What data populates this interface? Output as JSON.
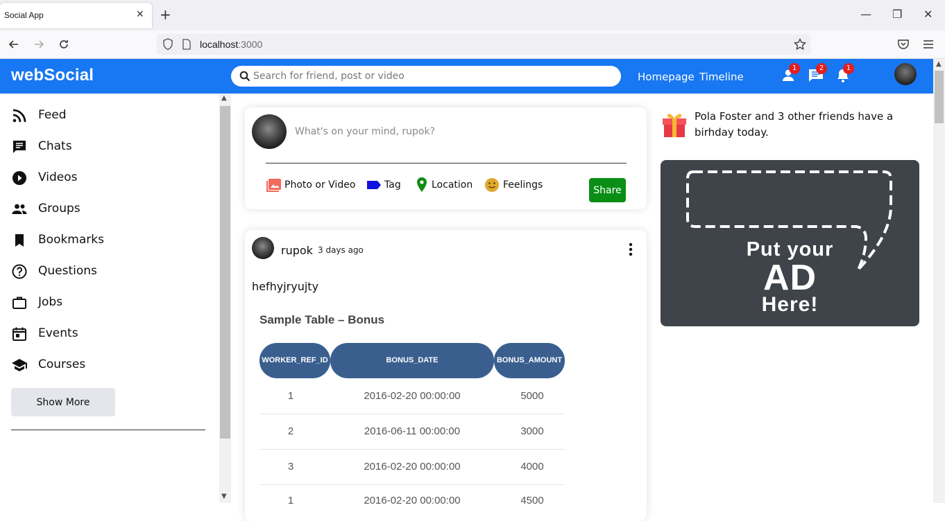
{
  "browser": {
    "tab_title": "Social App",
    "url_host": "localhost",
    "url_port": ":3000"
  },
  "header": {
    "logo": "webSocial",
    "search_placeholder": "Search for friend, post or video",
    "links": [
      "Homepage",
      "Timeline"
    ],
    "badges": {
      "friends": "1",
      "messages": "2",
      "notifications": "1"
    },
    "brand_color": "#1877f2"
  },
  "sidebar": {
    "items": [
      {
        "label": "Feed",
        "icon": "rss-icon"
      },
      {
        "label": "Chats",
        "icon": "chat-icon"
      },
      {
        "label": "Videos",
        "icon": "play-circle-icon"
      },
      {
        "label": "Groups",
        "icon": "group-icon"
      },
      {
        "label": "Bookmarks",
        "icon": "bookmark-icon"
      },
      {
        "label": "Questions",
        "icon": "help-circle-icon"
      },
      {
        "label": "Jobs",
        "icon": "briefcase-icon"
      },
      {
        "label": "Events",
        "icon": "calendar-icon"
      },
      {
        "label": "Courses",
        "icon": "school-icon"
      }
    ],
    "show_more": "Show More"
  },
  "share": {
    "placeholder": "What's on your mind, rupok?",
    "options": [
      "Photo or Video",
      "Tag",
      "Location",
      "Feelings"
    ],
    "button": "Share"
  },
  "post": {
    "username": "rupok",
    "time": "3 days ago",
    "text": "hefhyjryujty",
    "image_table": {
      "title": "Sample Table – Bonus",
      "headers": [
        "WORKER_REF_ID",
        "BONUS_DATE",
        "BONUS_AMOUNT"
      ],
      "rows": [
        [
          "1",
          "2016-02-20 00:00:00",
          "5000"
        ],
        [
          "2",
          "2016-06-11 00:00:00",
          "3000"
        ],
        [
          "3",
          "2016-02-20 00:00:00",
          "4000"
        ],
        [
          "1",
          "2016-02-20 00:00:00",
          "4500"
        ]
      ]
    }
  },
  "rightbar": {
    "birthday_text": "Pola Foster and 3 other friends have a birhday today.",
    "ad": {
      "line1": "Put your",
      "line2": "AD",
      "line3": "Here!"
    }
  }
}
